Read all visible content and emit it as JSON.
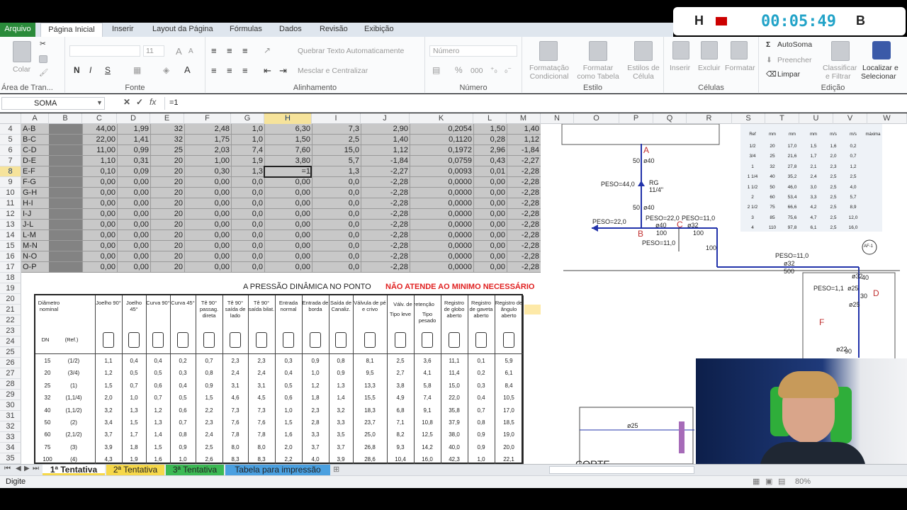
{
  "timer": {
    "left_key": "H",
    "time": "00:05:49",
    "right_key": "B"
  },
  "ribbon_tabs": [
    "Arquivo",
    "Página Inicial",
    "Inserir",
    "Layout da Página",
    "Fórmulas",
    "Dados",
    "Revisão",
    "Exibição"
  ],
  "clipboard": {
    "paste": "Colar",
    "group": "Área de Tran..."
  },
  "font": {
    "size": "11",
    "group": "Fonte",
    "bold": "N",
    "italic": "I",
    "underline": "S",
    "grow": "A",
    "shrink": "A"
  },
  "alignment": {
    "wrap": "Quebrar Texto Automaticamente",
    "merge": "Mesclar e Centralizar",
    "group": "Alinhamento"
  },
  "number": {
    "format": "Número",
    "percent": "%",
    "thousands": "000",
    "group": "Número"
  },
  "styles": {
    "conditional": [
      "Formatação",
      "Condicional"
    ],
    "table": [
      "Formatar",
      "como Tabela"
    ],
    "cell": [
      "Estilos de",
      "Célula"
    ],
    "group": "Estilo"
  },
  "cells": {
    "insert": "Inserir",
    "delete": "Excluir",
    "format": "Formatar",
    "group": "Células"
  },
  "editing": {
    "autosum": "AutoSoma",
    "fill": "Preencher",
    "clear": "Limpar",
    "sort": [
      "Classificar",
      "e Filtrar"
    ],
    "find": [
      "Localizar e",
      "Selecionar"
    ],
    "group": "Edição"
  },
  "formula_bar": {
    "name_box": "SOMA",
    "fx": "fx",
    "value": "=1"
  },
  "columns": [
    "A",
    "B",
    "C",
    "D",
    "E",
    "F",
    "G",
    "H",
    "I",
    "J",
    "K",
    "L",
    "M",
    "N",
    "O",
    "P",
    "Q",
    "R",
    "S",
    "T",
    "U",
    "V",
    "W"
  ],
  "rows": [
    "4",
    "5",
    "6",
    "7",
    "8",
    "9",
    "10",
    "11",
    "12",
    "13",
    "14",
    "15",
    "16",
    "17",
    "18",
    "19",
    "20",
    "21",
    "22",
    "23",
    "24",
    "25",
    "26",
    "27",
    "28",
    "29",
    "30",
    "31",
    "32",
    "33",
    "34",
    "35"
  ],
  "data_rows": [
    [
      "A-B",
      "44,00",
      "1,99",
      "32",
      "2,48",
      "1,0",
      "6,30",
      "7,3",
      "2,90",
      "0,2054",
      "1,50",
      "1,40"
    ],
    [
      "B-C",
      "22,00",
      "1,41",
      "32",
      "1,75",
      "1,0",
      "1,50",
      "2,5",
      "1,40",
      "0,1120",
      "0,28",
      "1,12"
    ],
    [
      "C-D",
      "11,00",
      "0,99",
      "25",
      "2,03",
      "7,4",
      "7,60",
      "15,0",
      "1,12",
      "0,1972",
      "2,96",
      "-1,84"
    ],
    [
      "D-E",
      "1,10",
      "0,31",
      "20",
      "1,00",
      "1,9",
      "3,80",
      "5,7",
      "-1,84",
      "0,0759",
      "0,43",
      "-2,27"
    ],
    [
      "E-F",
      "0,10",
      "0,09",
      "20",
      "0,30",
      "1,3",
      "=1",
      "1,3",
      "-2,27",
      "0,0093",
      "0,01",
      "-2,28"
    ],
    [
      "F-G",
      "0,00",
      "0,00",
      "20",
      "0,00",
      "0,0",
      "0,00",
      "0,0",
      "-2,28",
      "0,0000",
      "0,00",
      "-2,28"
    ],
    [
      "G-H",
      "0,00",
      "0,00",
      "20",
      "0,00",
      "0,0",
      "0,00",
      "0,0",
      "-2,28",
      "0,0000",
      "0,00",
      "-2,28"
    ],
    [
      "H-I",
      "0,00",
      "0,00",
      "20",
      "0,00",
      "0,0",
      "0,00",
      "0,0",
      "-2,28",
      "0,0000",
      "0,00",
      "-2,28"
    ],
    [
      "I-J",
      "0,00",
      "0,00",
      "20",
      "0,00",
      "0,0",
      "0,00",
      "0,0",
      "-2,28",
      "0,0000",
      "0,00",
      "-2,28"
    ],
    [
      "J-L",
      "0,00",
      "0,00",
      "20",
      "0,00",
      "0,0",
      "0,00",
      "0,0",
      "-2,28",
      "0,0000",
      "0,00",
      "-2,28"
    ],
    [
      "L-M",
      "0,00",
      "0,00",
      "20",
      "0,00",
      "0,0",
      "0,00",
      "0,0",
      "-2,28",
      "0,0000",
      "0,00",
      "-2,28"
    ],
    [
      "M-N",
      "0,00",
      "0,00",
      "20",
      "0,00",
      "0,0",
      "0,00",
      "0,0",
      "-2,28",
      "0,0000",
      "0,00",
      "-2,28"
    ],
    [
      "N-O",
      "0,00",
      "0,00",
      "20",
      "0,00",
      "0,0",
      "0,00",
      "0,0",
      "-2,28",
      "0,0000",
      "0,00",
      "-2,28"
    ],
    [
      "O-P",
      "0,00",
      "0,00",
      "20",
      "0,00",
      "0,0",
      "0,00",
      "0,0",
      "-2,28",
      "0,0000",
      "0,00",
      "-2,28"
    ]
  ],
  "note_pressure": "A PRESSÃO DINÂMICA NO PONTO",
  "note_warning": "NÃO ATENDE AO MINIMO NECESSÁRIO",
  "warning_color": "#e02020",
  "fittings_table": {
    "headers": [
      "Diâmetro nominal",
      "Joelho 90°",
      "Joelho 45°",
      "Curva 90°",
      "Curva 45°",
      "Tê 90° passag. direta",
      "Tê 90° saída de lado",
      "Tê 90° saída bilat.",
      "Entrada normal",
      "Entrada de borda",
      "Saída de Canaliz.",
      "Válvula de pé e crivo",
      "Tipo leve",
      "Tipo pesado",
      "Registro de globo aberto",
      "Registro de gaveta aberto",
      "Registro de ângulo aberto"
    ],
    "retention_label": "Válv. de retenção",
    "dn_label": "DN",
    "ref_label": "(Ref.)",
    "rows": [
      [
        "15",
        "(1/2)",
        "1,1",
        "0,4",
        "0,4",
        "0,2",
        "0,7",
        "2,3",
        "2,3",
        "0,3",
        "0,9",
        "0,8",
        "8,1",
        "2,5",
        "3,6",
        "11,1",
        "0,1",
        "5,9"
      ],
      [
        "20",
        "(3/4)",
        "1,2",
        "0,5",
        "0,5",
        "0,3",
        "0,8",
        "2,4",
        "2,4",
        "0,4",
        "1,0",
        "0,9",
        "9,5",
        "2,7",
        "4,1",
        "11,4",
        "0,2",
        "6,1"
      ],
      [
        "25",
        "(1)",
        "1,5",
        "0,7",
        "0,6",
        "0,4",
        "0,9",
        "3,1",
        "3,1",
        "0,5",
        "1,2",
        "1,3",
        "13,3",
        "3,8",
        "5,8",
        "15,0",
        "0,3",
        "8,4"
      ],
      [
        "32",
        "(1,1/4)",
        "2,0",
        "1,0",
        "0,7",
        "0,5",
        "1,5",
        "4,6",
        "4,5",
        "0,6",
        "1,8",
        "1,4",
        "15,5",
        "4,9",
        "7,4",
        "22,0",
        "0,4",
        "10,5"
      ],
      [
        "40",
        "(1,1/2)",
        "3,2",
        "1,3",
        "1,2",
        "0,6",
        "2,2",
        "7,3",
        "7,3",
        "1,0",
        "2,3",
        "3,2",
        "18,3",
        "6,8",
        "9,1",
        "35,8",
        "0,7",
        "17,0"
      ],
      [
        "50",
        "(2)",
        "3,4",
        "1,5",
        "1,3",
        "0,7",
        "2,3",
        "7,6",
        "7,6",
        "1,5",
        "2,8",
        "3,3",
        "23,7",
        "7,1",
        "10,8",
        "37,9",
        "0,8",
        "18,5"
      ],
      [
        "60",
        "(2,1/2)",
        "3,7",
        "1,7",
        "1,4",
        "0,8",
        "2,4",
        "7,8",
        "7,8",
        "1,6",
        "3,3",
        "3,5",
        "25,0",
        "8,2",
        "12,5",
        "38,0",
        "0,9",
        "19,0"
      ],
      [
        "75",
        "(3)",
        "3,9",
        "1,8",
        "1,5",
        "0,9",
        "2,5",
        "8,0",
        "8,0",
        "2,0",
        "3,7",
        "3,7",
        "26,8",
        "9,3",
        "14,2",
        "40,0",
        "0,9",
        "20,0"
      ],
      [
        "100",
        "(4)",
        "4,3",
        "1,9",
        "1,6",
        "1,0",
        "2,6",
        "8,3",
        "8,3",
        "2,2",
        "4,0",
        "3,9",
        "28,6",
        "10,4",
        "16,0",
        "42,3",
        "1,0",
        "22,1"
      ]
    ]
  },
  "mini_table": {
    "header": [
      "Ref",
      "mm",
      "mm",
      "mm",
      "m/s",
      "m/s",
      "máxima"
    ],
    "rows": [
      [
        "1/2",
        "20",
        "17,0",
        "1,5",
        "1,6",
        "0,2"
      ],
      [
        "3/4",
        "25",
        "21,6",
        "1,7",
        "2,0",
        "0,7"
      ],
      [
        "1",
        "32",
        "27,8",
        "2,1",
        "2,3",
        "1,2"
      ],
      [
        "1 1/4",
        "40",
        "35,2",
        "2,4",
        "2,5",
        "2,5"
      ],
      [
        "1 1/2",
        "50",
        "46,0",
        "3,0",
        "2,5",
        "4,0"
      ],
      [
        "2",
        "60",
        "53,4",
        "3,3",
        "2,5",
        "5,7"
      ],
      [
        "2 1/2",
        "75",
        "66,6",
        "4,2",
        "2,5",
        "8,9"
      ],
      [
        "3",
        "85",
        "75,6",
        "4,7",
        "2,5",
        "12,0"
      ],
      [
        "4",
        "110",
        "97,8",
        "6,1",
        "2,5",
        "16,0"
      ]
    ]
  },
  "drawing": {
    "point_a": "A",
    "point_b": "B",
    "point_c": "C",
    "point_d": "D",
    "point_f": "F",
    "d50a": "50",
    "o40a": "ø40",
    "peso44": "PESO=44,0",
    "rg": "RG",
    "rg_size": "11/4\"",
    "d50b": "50",
    "o40b": "ø40",
    "peso22a": "PESO=22,0",
    "peso22b": "PESO=22,0",
    "peso11a": "PESO=11,0",
    "o40c": "ø40",
    "o32a": "ø32",
    "d100a": "100",
    "d100b": "100",
    "peso11b": "PESO=11,0",
    "d100c": "100",
    "peso11c": "PESO=11,0",
    "o32b": "ø32",
    "d500": "500",
    "af": "AF-1",
    "peso11d": "PESO=1,1",
    "o25a": "ø25",
    "d30": "30",
    "d40": "40",
    "o32c": "ø32",
    "o25b": "ø25",
    "o22": "ø22",
    "d90": "90",
    "o25c": "ø25",
    "corte": "CORTE"
  },
  "sheet_tabs": [
    "1ª Tentativa",
    "2ª Tentativa",
    "3ª Tentativa",
    "Tabela para impressão"
  ],
  "sheet_tab_colors": [
    "#f6d84a",
    "#f6d84a",
    "#3cba54",
    "#4aa0e0"
  ],
  "status": {
    "mode": "Digite",
    "zoom": "80%"
  }
}
